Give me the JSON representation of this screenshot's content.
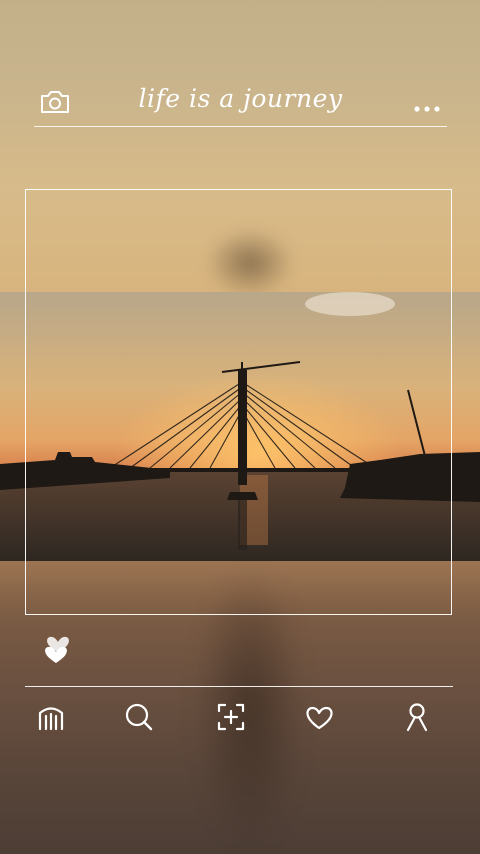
{
  "header": {
    "title": "life is a journey",
    "left_icon": "camera-icon",
    "right_icon": "more-dots-icon"
  },
  "post": {
    "photo_subject": "cable-stayed bridge at sunset",
    "like_icon": "heart-like-icon",
    "liked": true
  },
  "bottom_nav": {
    "items": [
      {
        "icon": "home-icon"
      },
      {
        "icon": "search-icon"
      },
      {
        "icon": "add-post-icon"
      },
      {
        "icon": "heart-icon"
      },
      {
        "icon": "profile-icon"
      }
    ]
  },
  "colors": {
    "line": "#ffffff",
    "sky_top": "#c3b089",
    "sun": "#ffb35a",
    "silhouette": "#1e1914"
  }
}
